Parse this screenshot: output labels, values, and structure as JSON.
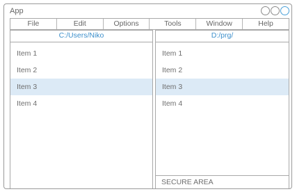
{
  "app": {
    "title": "App"
  },
  "menu": {
    "items": [
      {
        "label": "File"
      },
      {
        "label": "Edit"
      },
      {
        "label": "Options"
      },
      {
        "label": "Tools"
      },
      {
        "label": "Window"
      },
      {
        "label": "Help"
      }
    ]
  },
  "left_pane": {
    "path": "C:/Users/Niko",
    "items": [
      {
        "label": "Item 1"
      },
      {
        "label": "Item 2"
      },
      {
        "label": "Item 3"
      },
      {
        "label": "Item 4"
      }
    ],
    "selected_index": 2
  },
  "right_pane": {
    "path": "D:/prg/",
    "items": [
      {
        "label": "Item 1"
      },
      {
        "label": "Item 2"
      },
      {
        "label": "Item 3"
      },
      {
        "label": "Item 4"
      }
    ],
    "selected_index": 2,
    "status": "SECURE AREA"
  },
  "colors": {
    "accent": "#3d8fcb",
    "selection": "#dceaf6",
    "border": "#a8a8a8",
    "text": "#6e6e6e"
  },
  "icons": {
    "window_controls": [
      "circle-button-icon",
      "circle-button-icon",
      "circle-button-icon"
    ]
  }
}
